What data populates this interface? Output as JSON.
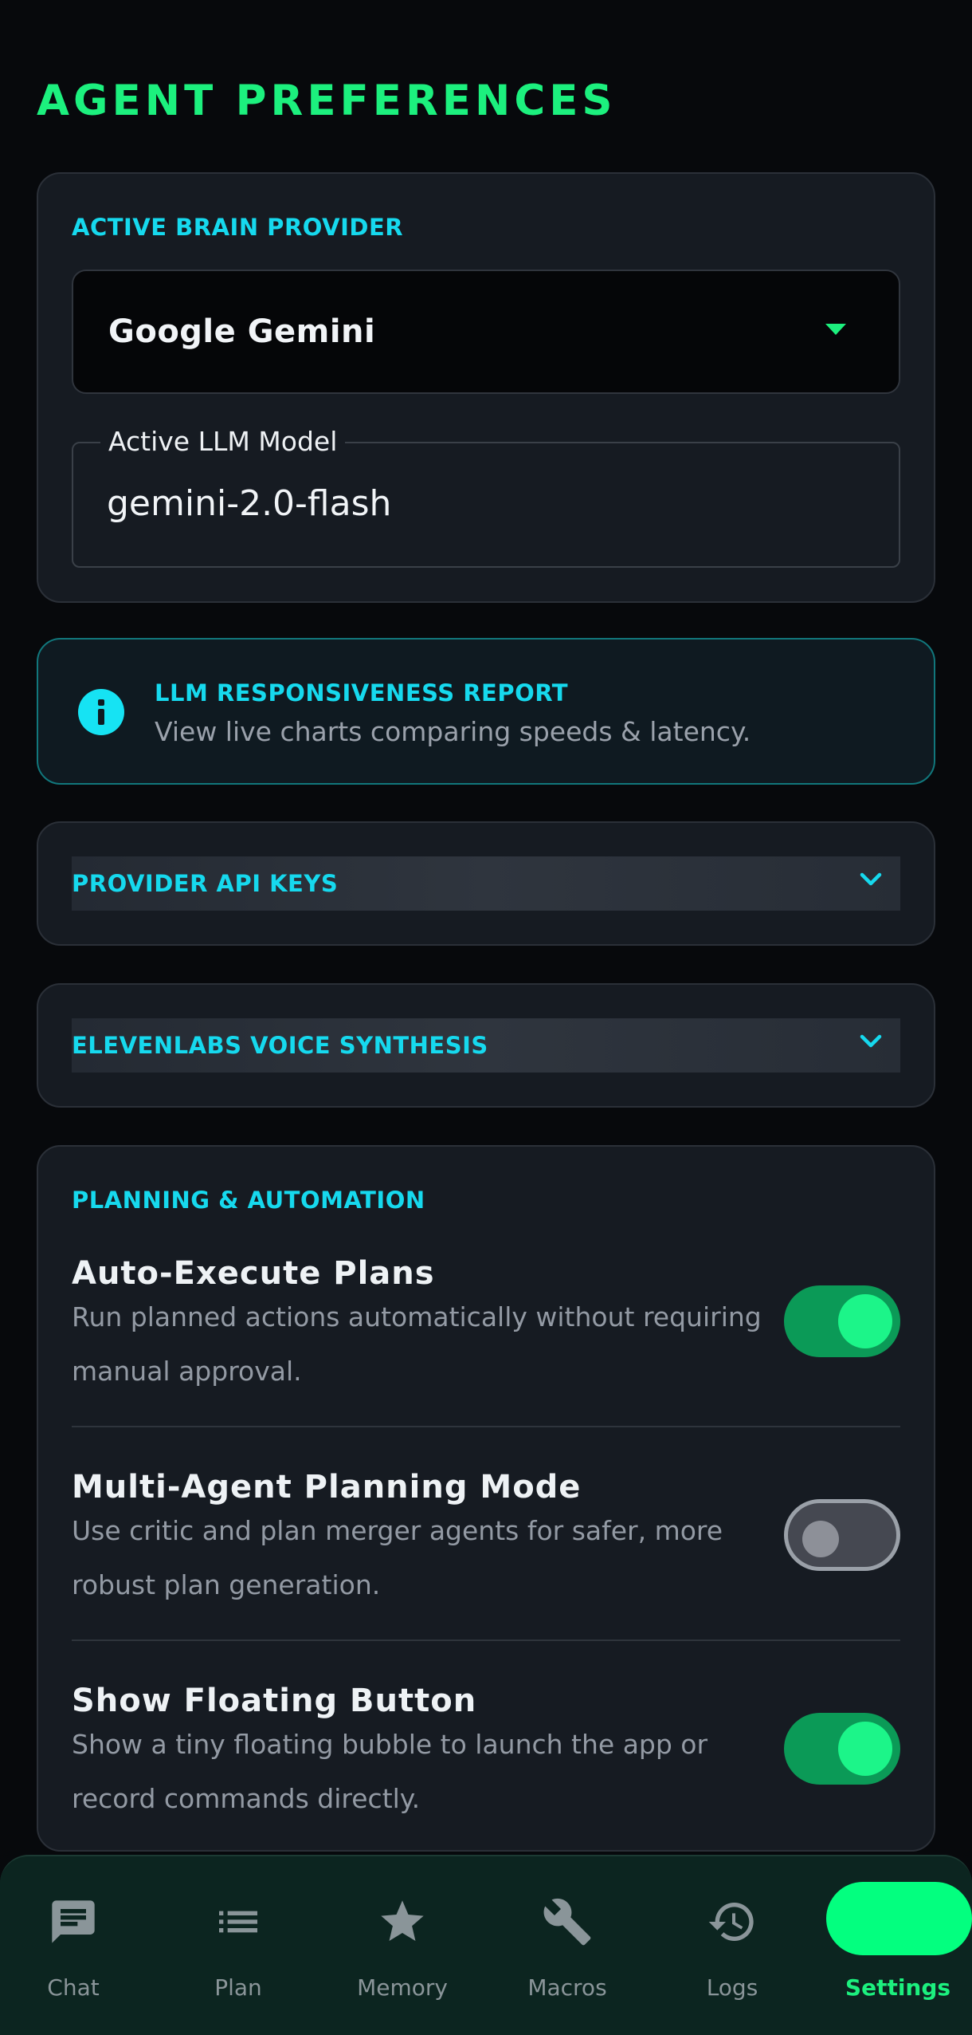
{
  "page": {
    "title": "AGENT PREFERENCES"
  },
  "brain": {
    "section_label": "ACTIVE BRAIN PROVIDER",
    "provider_value": "Google Gemini",
    "model_label": "Active LLM Model",
    "model_value": "gemini-2.0-flash"
  },
  "report": {
    "title": "LLM RESPONSIVENESS REPORT",
    "text": "View live charts comparing speeds & latency.",
    "icon": "info-icon"
  },
  "api_keys": {
    "title": "PROVIDER API KEYS",
    "icon": "chevron-down-icon"
  },
  "voice": {
    "title": "ELEVENLABS VOICE SYNTHESIS",
    "icon": "chevron-down-icon"
  },
  "automation": {
    "section_label": "PLANNING & AUTOMATION",
    "settings": [
      {
        "title": "Auto-Execute Plans",
        "desc": "Run planned actions automatically without requiring manual approval.",
        "enabled": true
      },
      {
        "title": "Multi-Agent Planning Mode",
        "desc": "Use critic and plan merger agents for safer, more robust plan generation.",
        "enabled": false
      },
      {
        "title": "Show Floating Button",
        "desc": "Show a tiny floating bubble to launch the app or record commands directly.",
        "enabled": true
      }
    ]
  },
  "nav": {
    "items": [
      {
        "label": "Chat",
        "icon": "chat-icon"
      },
      {
        "label": "Plan",
        "icon": "list-icon"
      },
      {
        "label": "Memory",
        "icon": "star-icon"
      },
      {
        "label": "Macros",
        "icon": "wrench-icon"
      },
      {
        "label": "Logs",
        "icon": "history-icon"
      },
      {
        "label": "Settings",
        "icon": "settings-icon",
        "active": true
      }
    ]
  },
  "colors": {
    "accent_green": "#1cf07e",
    "accent_cyan": "#16d9ee",
    "background": "#07090c",
    "card": "#161b22",
    "nav_background": "#0c2520"
  }
}
